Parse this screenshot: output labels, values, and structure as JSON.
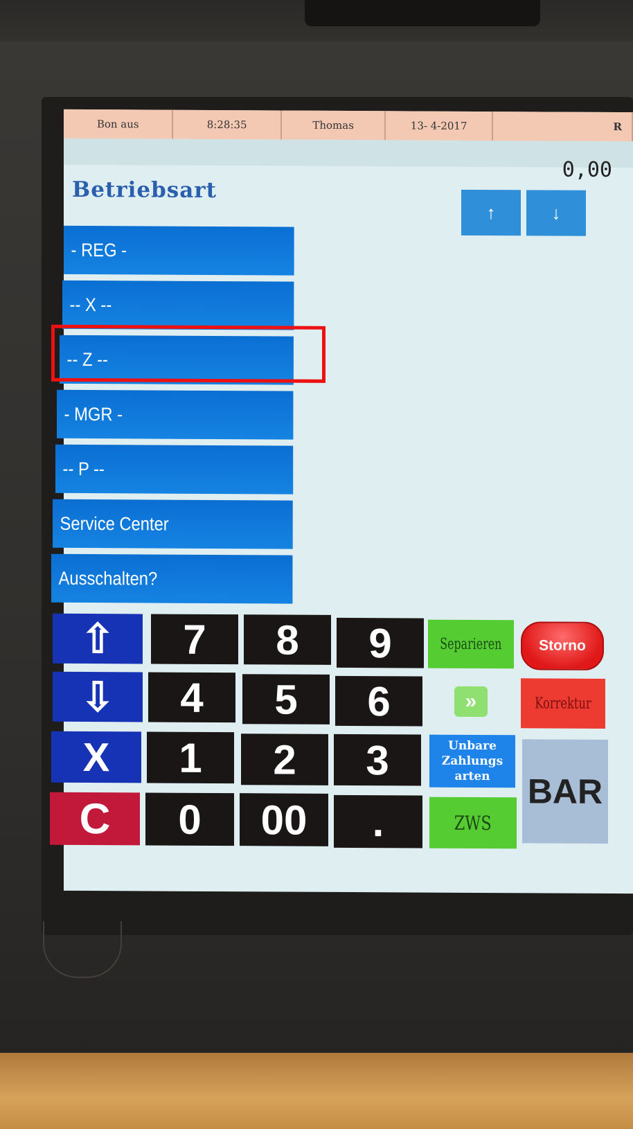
{
  "statusbar": {
    "mode": "Bon aus",
    "time": "8:28:35",
    "user": "Thomas",
    "date": "13- 4-2017",
    "flag": "R"
  },
  "amount": "0,00",
  "title": "Betriebsart",
  "scroll": {
    "up_icon": "↑",
    "down_icon": "↓"
  },
  "menu": [
    {
      "label": "- REG -"
    },
    {
      "label": "-- X --"
    },
    {
      "label": "-- Z --"
    },
    {
      "label": "- MGR -"
    },
    {
      "label": "-- P --"
    },
    {
      "label": "Service Center"
    },
    {
      "label": "Ausschalten?"
    }
  ],
  "keypad": {
    "up_icon": "⇧",
    "down_icon": "⇩",
    "x": "X",
    "c": "C",
    "k7": "7",
    "k8": "8",
    "k9": "9",
    "k4": "4",
    "k5": "5",
    "k6": "6",
    "k1": "1",
    "k2": "2",
    "k3": "3",
    "k0": "0",
    "k00": "00",
    "dot": ".",
    "separieren": "Separieren",
    "storno": "Storno",
    "forward_icon": "»",
    "korrektur": "Korrektur",
    "unbare": "Unbare Zahlungs arten",
    "zws": "ZWS",
    "bar": "BAR"
  }
}
